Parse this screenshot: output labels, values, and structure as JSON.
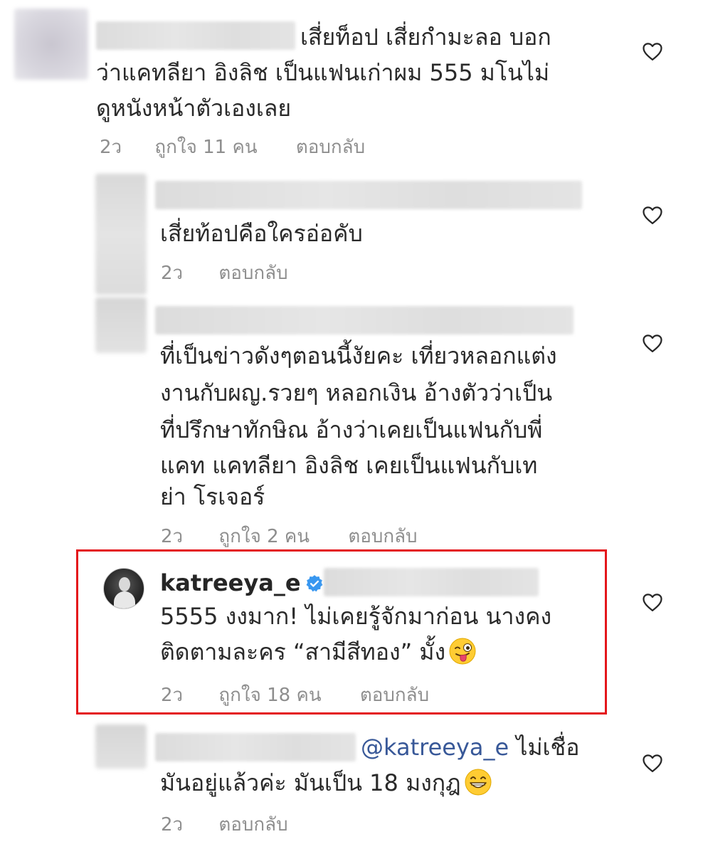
{
  "comments": [
    {
      "lines": [
        "เสี่ยท็อป เสี่ยกำมะลอ บอก",
        "ว่าแคทลียา อิงลิช เป็นแฟนเก่าผม 555  มโนไม่",
        "ดูหนังหน้าตัวเองเลย"
      ],
      "time": "2ว",
      "likes": "ถูกใจ 11 คน",
      "reply": "ตอบกลับ"
    },
    {
      "lines": [
        "เสี่ยท้อปคือใครอ่อคับ"
      ],
      "time": "2ว",
      "reply": "ตอบกลับ"
    },
    {
      "lines": [
        "ที่เป็นข่าวดังๆตอนนี้งัยคะ เที่ยวหลอกแต่ง",
        "งานกับผญ.รวยๆ หลอกเงิน อ้างตัวว่าเป็น",
        "ที่ปรึกษาทักษิณ อ้างว่าเคยเป็นแฟนกับพี่",
        "แคท แคทลียา อิงลิช เคยเป็นแฟนกับเท",
        "ย่า โรเจอร์"
      ],
      "time": "2ว",
      "likes": "ถูกใจ 2 คน",
      "reply": "ตอบกลับ"
    },
    {
      "username": "katreeya_e",
      "lines": [
        "5555 งงมาก! ไม่เคยรู้จักมาก่อน นางคง",
        "ติดตามละคร “สามีสีทอง” มั้ง"
      ],
      "time": "2ว",
      "likes": "ถูกใจ 18 คน",
      "reply": "ตอบกลับ"
    },
    {
      "mention": "@katreeya_e",
      "line1_rest": " ไม่เชื่อ",
      "line2": "มันอยู่แล้วค่ะ มันเป็น 18 มงกุฎ",
      "time": "2ว",
      "reply": "ตอบกลับ"
    }
  ],
  "icons": {
    "heart": "heart-outline-icon",
    "verified": "verified-badge-icon",
    "emoji_wink": "winking-face-with-tongue",
    "emoji_grin": "grinning-face-with-smiling-eyes"
  },
  "colors": {
    "highlight_border": "#e4161b",
    "verified_blue": "#3897f0",
    "mention_blue": "#385898",
    "meta_gray": "#8e8e8e"
  }
}
